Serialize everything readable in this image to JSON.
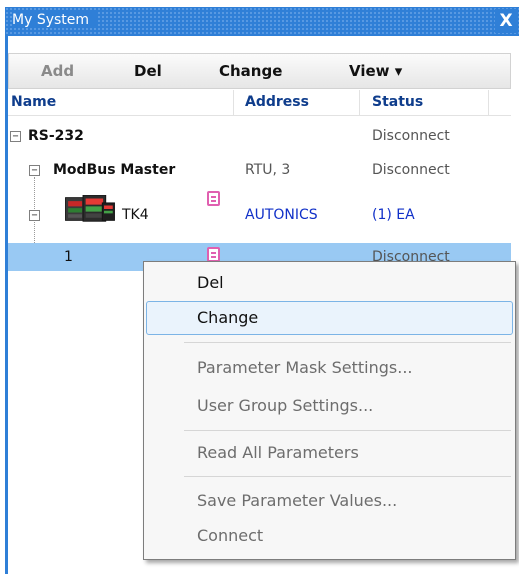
{
  "window": {
    "title": "My System",
    "close_glyph": "X"
  },
  "toolbar": {
    "add": "Add",
    "del": "Del",
    "change": "Change",
    "view": "View ▾"
  },
  "columns": {
    "name": "Name",
    "address": "Address",
    "status": "Status"
  },
  "tree": {
    "rs232": {
      "name": "RS-232",
      "status": "Disconnect",
      "expander": "−"
    },
    "modbus": {
      "name": "ModBus Master",
      "address": "RTU, 3",
      "status": "Disconnect",
      "expander": "−"
    },
    "tk4": {
      "name": "TK4",
      "address": "AUTONICS",
      "status": "(1) EA",
      "expander": "−"
    },
    "unit1": {
      "name": "1",
      "status": "Disconnect"
    }
  },
  "context_menu": {
    "items": [
      {
        "label": "Del",
        "enabled": true
      },
      {
        "label": "Change",
        "enabled": true
      },
      {
        "label": "Parameter Mask Settings...",
        "enabled": false
      },
      {
        "label": "User Group Settings...",
        "enabled": false
      },
      {
        "label": "Read All Parameters",
        "enabled": false
      },
      {
        "label": "Save Parameter Values...",
        "enabled": false
      },
      {
        "label": "Connect",
        "enabled": false
      }
    ]
  },
  "colors": {
    "titlebar": "#2f7fd7",
    "selection": "#99c9f3",
    "header_text": "#0f3d8c",
    "link_blue": "#1030c8",
    "list_icon": "#e060b0"
  },
  "icons": {
    "close": "close-icon",
    "device": "tk4-controller-icon",
    "list": "parameter-list-icon"
  }
}
